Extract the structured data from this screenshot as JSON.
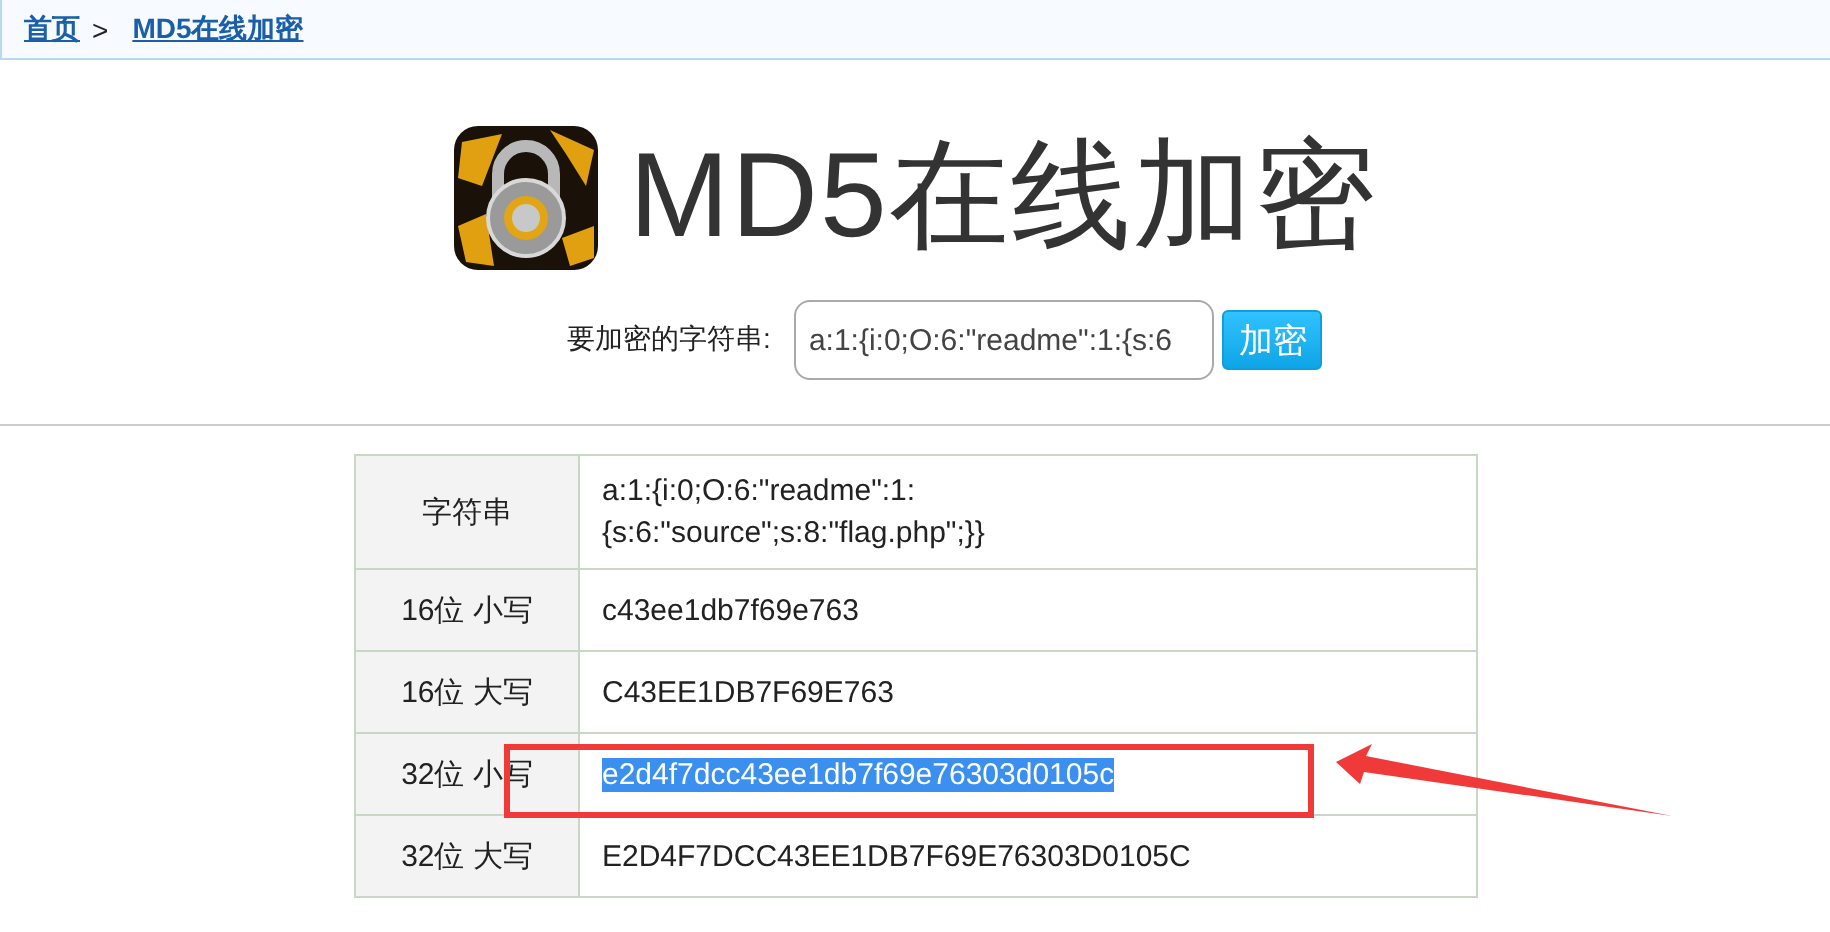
{
  "breadcrumb": [
    {
      "label": "首页"
    },
    {
      "label": "MD5在线加密"
    }
  ],
  "breadcrumb_separator": ">",
  "title": "MD5在线加密",
  "form": {
    "label": "要加密的字符串:",
    "value": "a:1:{i:0;O:6:\"readme\":1:{s:6",
    "button": "加密"
  },
  "results": [
    {
      "label": "字符串",
      "value": "a:1:{i:0;O:6:\"readme\":1:\n{s:6:\"source\";s:8:\"flag.php\";}}",
      "highlighted": false
    },
    {
      "label": "16位 小写",
      "value": "c43ee1db7f69e763",
      "highlighted": false
    },
    {
      "label": "16位 大写",
      "value": "C43EE1DB7F69E763",
      "highlighted": false
    },
    {
      "label": "32位 小写",
      "value": "e2d4f7dcc43ee1db7f69e76303d0105c",
      "highlighted": true
    },
    {
      "label": "32位 大写",
      "value": "E2D4F7DCC43EE1DB7F69E76303D0105C",
      "highlighted": false
    }
  ]
}
